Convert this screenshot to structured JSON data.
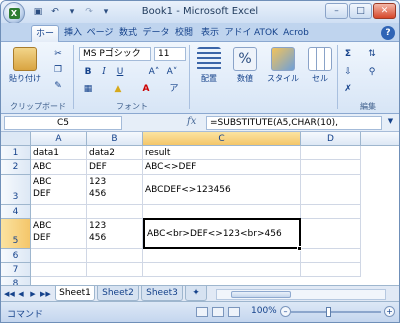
{
  "title": "Book1 - Microsoft Excel",
  "ribbon_tabs": [
    "ホーム",
    "挿入",
    "ページ",
    "数式",
    "データ",
    "校閲",
    "表示",
    "アドイ",
    "ATOK",
    "Acrob"
  ],
  "clipboard": {
    "paste_label": "貼り付け",
    "group_label": "クリップボード"
  },
  "font": {
    "name": "MS Pゴシック",
    "size": "11",
    "group_label": "フォント"
  },
  "align": {
    "label": "配置"
  },
  "number": {
    "label": "数値"
  },
  "style": {
    "label": "スタイル"
  },
  "cells": {
    "label": "セル"
  },
  "edit": {
    "label": "編集"
  },
  "formula_bar": {
    "name_box": "C5",
    "fx": "fx",
    "formula": "=SUBSTITUTE(A5,CHAR(10),"
  },
  "columns": [
    "A",
    "B",
    "C",
    "D"
  ],
  "rows": [
    "1",
    "2",
    "3",
    "4",
    "5",
    "6",
    "7",
    "8"
  ],
  "cells_data": {
    "A1": "data1",
    "B1": "data2",
    "C1": "result",
    "A2": "ABC",
    "B2": "DEF",
    "C2": "ABC<>DEF",
    "A3": "ABC\nDEF",
    "B3": "123\n456",
    "C3": "ABCDEF<>123456",
    "A5": "ABC\nDEF",
    "B5": "123\n456",
    "C5": "ABC<br>DEF<>123<br>456"
  },
  "sheets": [
    "Sheet1",
    "Sheet2",
    "Sheet3"
  ],
  "status": {
    "mode": "コマンド",
    "zoom": "100%"
  }
}
